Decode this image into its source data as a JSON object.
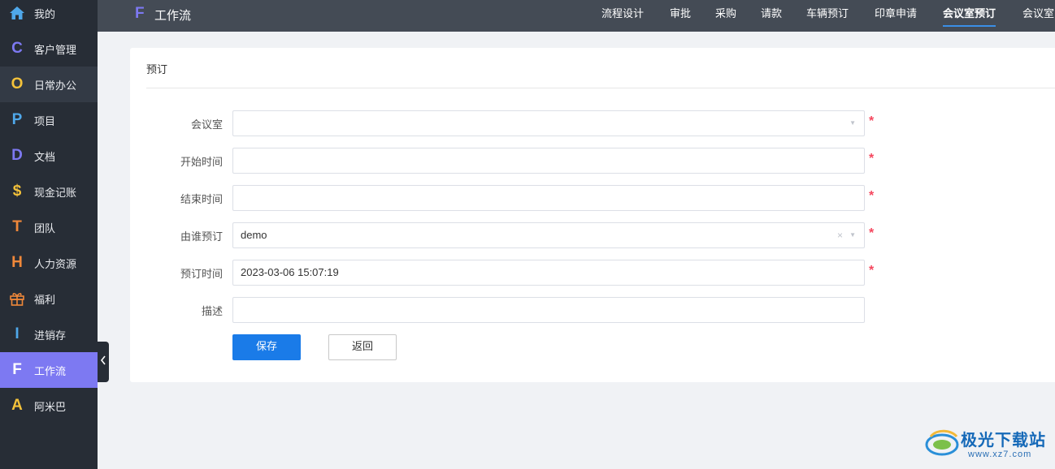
{
  "sidebar": {
    "items": [
      {
        "label": "我的",
        "icon": "home-icon",
        "glyph": "⌂",
        "color": "#4fa8ea"
      },
      {
        "label": "客户管理",
        "icon": "letter-c-icon",
        "glyph": "C",
        "color": "#7d79f2"
      },
      {
        "label": "日常办公",
        "icon": "letter-o-icon",
        "glyph": "O",
        "color": "#f4c23a"
      },
      {
        "label": "项目",
        "icon": "letter-p-icon",
        "glyph": "P",
        "color": "#4fa8ea"
      },
      {
        "label": "文档",
        "icon": "letter-d-icon",
        "glyph": "D",
        "color": "#7d79f2"
      },
      {
        "label": "现金记账",
        "icon": "dollar-icon",
        "glyph": "$",
        "color": "#f4c23a"
      },
      {
        "label": "团队",
        "icon": "letter-t-icon",
        "glyph": "T",
        "color": "#f0883a"
      },
      {
        "label": "人力资源",
        "icon": "letter-h-icon",
        "glyph": "H",
        "color": "#f0883a"
      },
      {
        "label": "福利",
        "icon": "gift-icon",
        "glyph": "",
        "color": "#f0883a"
      },
      {
        "label": "进销存",
        "icon": "letter-i-icon",
        "glyph": "I",
        "color": "#4fa8ea"
      },
      {
        "label": "工作流",
        "icon": "letter-f-icon",
        "glyph": "F",
        "color": "#ffffff"
      },
      {
        "label": "阿米巴",
        "icon": "letter-a-icon",
        "glyph": "A",
        "color": "#f4c23a"
      }
    ],
    "active_index": 10,
    "hover_index": 2
  },
  "header": {
    "logo_glyph": "F",
    "title": "工作流",
    "tabs": [
      {
        "label": "流程设计"
      },
      {
        "label": "审批"
      },
      {
        "label": "采购"
      },
      {
        "label": "请款"
      },
      {
        "label": "车辆预订"
      },
      {
        "label": "印章申请"
      },
      {
        "label": "会议室预订"
      },
      {
        "label": "会议室"
      }
    ],
    "active_tab": "会议室预订"
  },
  "form": {
    "title": "预订",
    "fields": {
      "room": {
        "label": "会议室",
        "value": "",
        "required": "*",
        "arrow": "▼"
      },
      "start": {
        "label": "开始时间",
        "value": "",
        "required": "*"
      },
      "end": {
        "label": "结束时间",
        "value": "",
        "required": "*"
      },
      "booker": {
        "label": "由谁预订",
        "value": "demo",
        "required": "*",
        "clear": "×",
        "arrow": "▼"
      },
      "booked_at": {
        "label": "预订时间",
        "value": "2023-03-06 15:07:19",
        "required": "*"
      },
      "description": {
        "label": "描述",
        "value": ""
      }
    },
    "save_label": "保存",
    "back_label": "返回"
  },
  "watermark": {
    "text": "极光下载站",
    "url": "www.xz7.com"
  },
  "colors": {
    "accent": "#7d79f2",
    "primary_button": "#1a7be8",
    "required": "#f5475e",
    "sidebar_bg": "#272d36",
    "topbar_bg": "#444b55"
  }
}
